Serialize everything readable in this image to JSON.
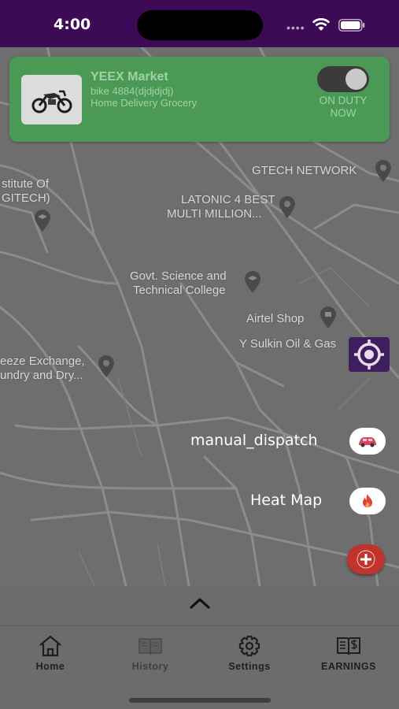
{
  "status_bar": {
    "time": "4:00",
    "signal_dots": "••••",
    "icons": [
      "wifi-icon",
      "battery-icon"
    ]
  },
  "driver_card": {
    "name": "YEEX Market",
    "vehicle": "bike 4884(djdjdjdj)",
    "service": "Home Delivery Grocery",
    "duty_status": "ON DUTY NOW",
    "duty_on": true,
    "vehicle_icon": "motorcycle-icon"
  },
  "map": {
    "labels": [
      {
        "name": "GTECH NETWORK"
      },
      {
        "name": "LATONIC 4 BEST MULTI MILLION..."
      },
      {
        "name": "stitute Of GITECH)"
      },
      {
        "name": "Govt. Science and Technical College"
      },
      {
        "name": "Airtel Shop"
      },
      {
        "name": "Y Sulkin Oil & Gas"
      },
      {
        "name": "eeze Exchange, undry and Dry..."
      }
    ],
    "label_lines": {
      "latonic_1": "LATONIC 4 BEST",
      "latonic_2": "MULTI MILLION...",
      "institute_1": "stitute Of",
      "institute_2": "GITECH)",
      "govt_1": "Govt. Science and",
      "govt_2": "Technical College",
      "breeze_1": "eeze Exchange,",
      "breeze_2": "undry and Dry..."
    }
  },
  "actions": {
    "manual_dispatch_label": "manual_dispatch",
    "heat_map_label": "Heat Map",
    "manual_dispatch_icon": "car-icon",
    "heat_map_icon": "fire-icon",
    "add_icon": "plus-icon",
    "locate_icon": "crosshair-icon"
  },
  "bottom_nav": {
    "expand_icon": "chevron-up-icon",
    "items": [
      {
        "label": "Home",
        "icon": "home-icon"
      },
      {
        "label": "History",
        "icon": "book-icon"
      },
      {
        "label": "Settings",
        "icon": "gear-icon"
      },
      {
        "label": "EARNINGS",
        "icon": "ledger-icon"
      }
    ]
  },
  "colors": {
    "status_bar": "#3d0a55",
    "card_green": "#4a9a55",
    "locate_purple": "#3f1e5e",
    "add_red": "#c0342d",
    "map_gray": "#6e6e6e"
  }
}
